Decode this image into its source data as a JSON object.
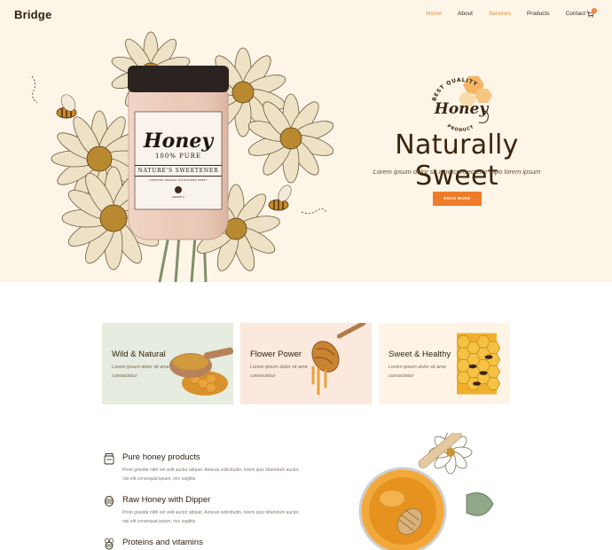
{
  "header": {
    "logo": "Bridge",
    "nav": [
      "Home",
      "About",
      "Services",
      "Products",
      "Contact"
    ],
    "cart_count": "0"
  },
  "hero": {
    "title": "Naturally Sweet",
    "subtitle": "Lorem ipsum dolor sit ame consectetur mpo lorem ipsum",
    "button_label": "READ MORE",
    "jar_label": {
      "brand": "Honey",
      "pure": "100% PURE",
      "tagline": "NATURE'S SWEETENER",
      "fine": "CERTIFIED ORGANIC WILDFLOWER HONEY",
      "grade": "GRADE A"
    },
    "badge": {
      "top_text": "BEST QUALITY",
      "main_text": "Honey",
      "bottom_text": "PRODUCT"
    }
  },
  "cards": [
    {
      "title": "Wild & Natural",
      "text": "Lorem ipsum dolor sit ame consectetur",
      "bg": "#e6ecdf"
    },
    {
      "title": "Flower Power",
      "text": "Lorem ipsum dolor sit ame consectetur",
      "bg": "#fbe9de"
    },
    {
      "title": "Sweet & Healthy",
      "text": "Lorem ipsum dolor sit ame consectetur",
      "bg": "#fdf4e6"
    }
  ],
  "features": [
    {
      "title": "Pure honey products",
      "text": "Proin gravida nibh vel velit auctor aliquet. Aenean sollicitudin, lorem quis bibendum auctor, nisi elit consequat ipsum, nec sagittis."
    },
    {
      "title": "Raw Honey with Dipper",
      "text": "Proin gravida nibh vel velit auctor aliquet. Aenean sollicitudin, lorem quis bibendum auctor, nisi elit consequat ipsum, nec sagittis."
    },
    {
      "title": "Proteins and vitamins",
      "text": ""
    }
  ],
  "colors": {
    "accent": "#ef7c2a",
    "hero_bg": "#fdf5e8",
    "title_brown": "#3b240c"
  }
}
